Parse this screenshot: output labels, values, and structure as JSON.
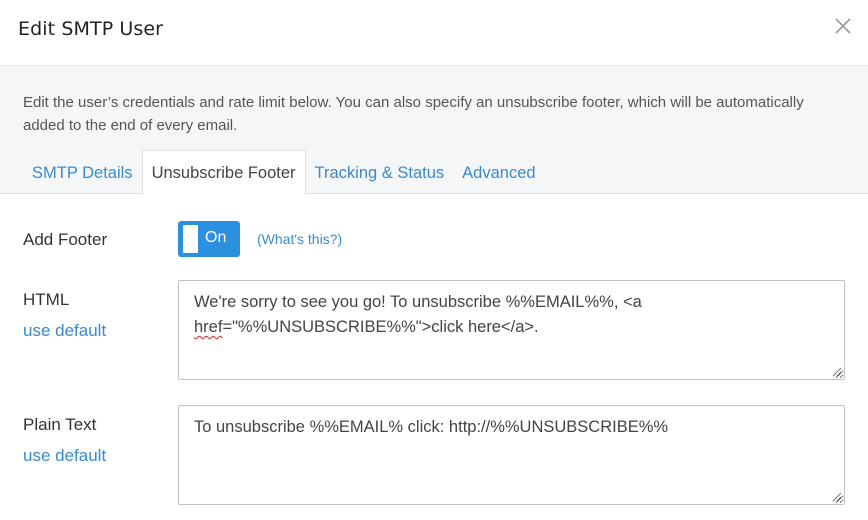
{
  "dialog": {
    "title": "Edit SMTP User",
    "close_icon": "close-icon"
  },
  "intro": {
    "description": "Edit the user’s credentials and rate limit below. You can also specify an unsubscribe footer, which will be automatically added to the end of every email."
  },
  "tabs": [
    {
      "label": "SMTP Details",
      "active": false
    },
    {
      "label": "Unsubscribe Footer",
      "active": true
    },
    {
      "label": "Tracking & Status",
      "active": false
    },
    {
      "label": "Advanced",
      "active": false
    }
  ],
  "add_footer": {
    "label": "Add Footer",
    "toggle_state": "On",
    "toggle_on": true,
    "help_link": "(What's this?)"
  },
  "html_footer": {
    "label": "HTML",
    "use_default_link": "use default",
    "value_part1": "We're sorry to see you go! To unsubscribe %%EMAIL%%, <a ",
    "value_misspelled": "href",
    "value_part2": "=\"%%UNSUBSCRIBE%%\">click here</a>."
  },
  "plain_text_footer": {
    "label": "Plain Text",
    "use_default_link": "use default",
    "value": "To unsubscribe %%EMAIL% click: http://%%UNSUBSCRIBE%%"
  },
  "colors": {
    "accent": "#2b90de",
    "link": "#3a8ad0",
    "intro_bg": "#f5f6f8"
  }
}
